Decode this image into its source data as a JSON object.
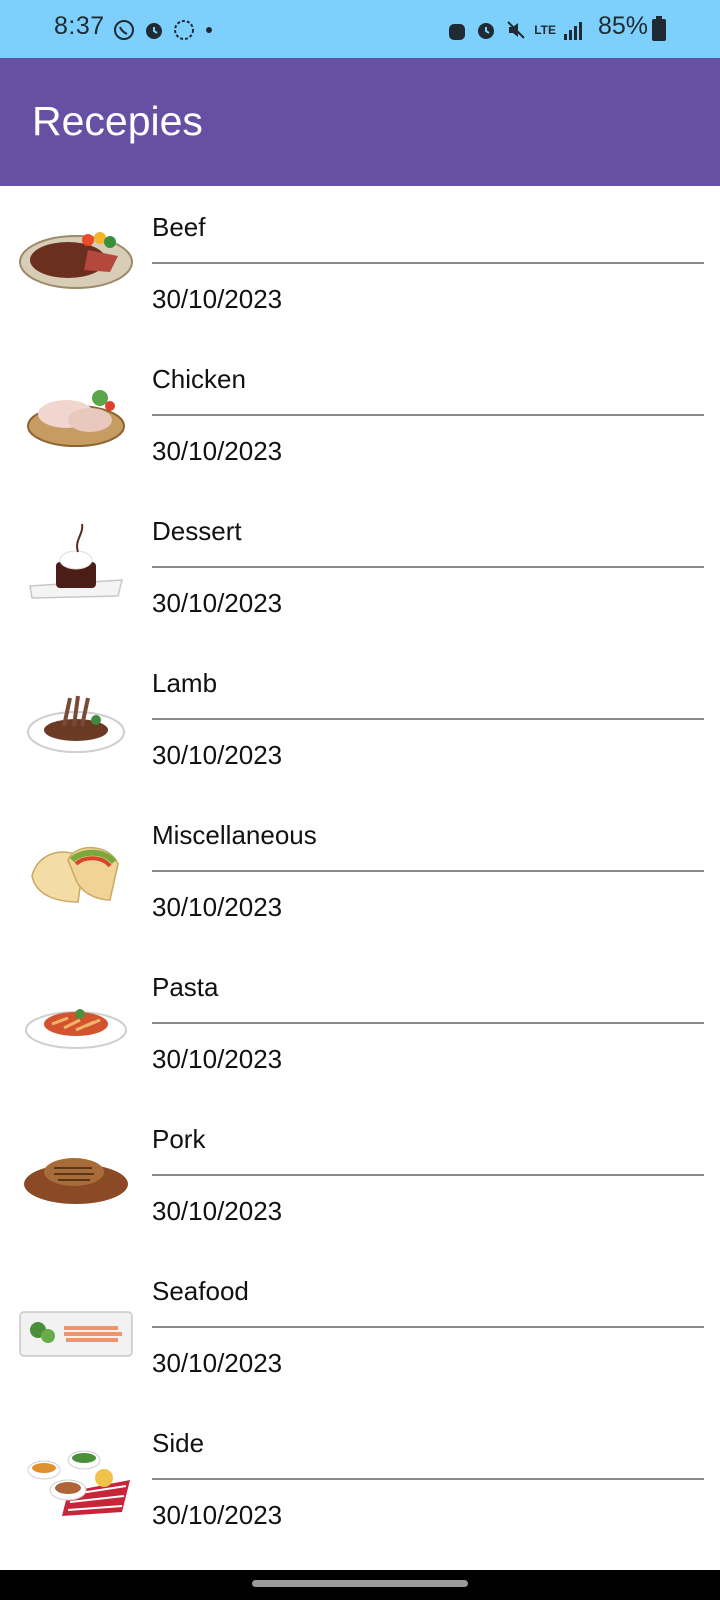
{
  "status_bar": {
    "time": "8:37",
    "battery_percent": "85%",
    "network": "LTE"
  },
  "app_bar": {
    "title": "Recepies"
  },
  "recipes": [
    {
      "name": "Beef",
      "date": "30/10/2023"
    },
    {
      "name": "Chicken",
      "date": "30/10/2023"
    },
    {
      "name": "Dessert",
      "date": "30/10/2023"
    },
    {
      "name": "Lamb",
      "date": "30/10/2023"
    },
    {
      "name": "Miscellaneous",
      "date": "30/10/2023"
    },
    {
      "name": "Pasta",
      "date": "30/10/2023"
    },
    {
      "name": "Pork",
      "date": "30/10/2023"
    },
    {
      "name": "Seafood",
      "date": "30/10/2023"
    },
    {
      "name": "Side",
      "date": "30/10/2023"
    }
  ],
  "colors": {
    "status_bar": "#7cd0fb",
    "app_bar": "#6750a4",
    "divider": "#8a8a8a"
  }
}
